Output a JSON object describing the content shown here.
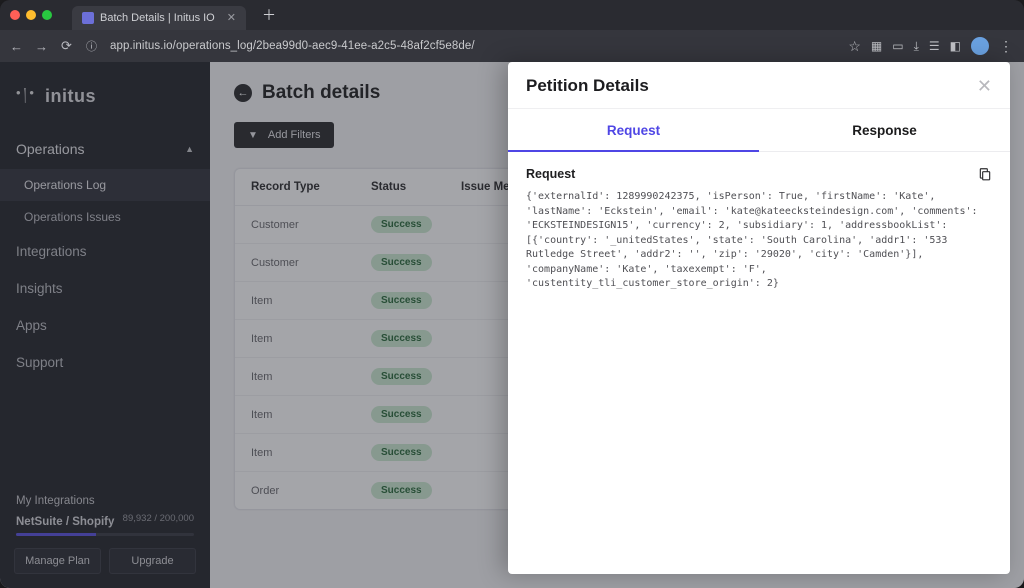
{
  "browser": {
    "tab_title": "Batch Details | Initus IO",
    "url": "app.initus.io/operations_log/2bea99d0-aec9-41ee-a2c5-48af2cf5e8de/"
  },
  "sidebar": {
    "brand": "initus",
    "sections": {
      "operations": {
        "label": "Operations"
      }
    },
    "items": [
      {
        "label": "Operations Log"
      },
      {
        "label": "Operations Issues"
      }
    ],
    "links": {
      "integrations": "Integrations",
      "insights": "Insights",
      "apps": "Apps",
      "support": "Support"
    },
    "my_integrations_label": "My Integrations",
    "integration": {
      "name": "NetSuite / Shopify",
      "count": "89,932 / 200,000"
    },
    "manage_plan": "Manage Plan",
    "upgrade": "Upgrade"
  },
  "main": {
    "title": "Batch details",
    "add_filters": "Add Filters",
    "columns": {
      "record_type": "Record Type",
      "status": "Status",
      "issue_message": "Issue Message"
    },
    "rows": [
      {
        "type": "Customer",
        "status": "Success"
      },
      {
        "type": "Customer",
        "status": "Success"
      },
      {
        "type": "Item",
        "status": "Success"
      },
      {
        "type": "Item",
        "status": "Success"
      },
      {
        "type": "Item",
        "status": "Success"
      },
      {
        "type": "Item",
        "status": "Success"
      },
      {
        "type": "Item",
        "status": "Success"
      },
      {
        "type": "Order",
        "status": "Success"
      }
    ]
  },
  "panel": {
    "title": "Petition Details",
    "tabs": {
      "request": "Request",
      "response": "Response"
    },
    "section_label": "Request",
    "code": "{'externalId': 1289990242375, 'isPerson': True, 'firstName': 'Kate', 'lastName': 'Eckstein', 'email': 'kate@kateecksteindesign.com', 'comments': 'ECKSTEINDESIGN15', 'currency': 2, 'subsidiary': 1, 'addressbookList': [{'country': '_unitedStates', 'state': 'South Carolina', 'addr1': '533 Rutledge Street', 'addr2': '', 'zip': '29020', 'city': 'Camden'}], 'companyName': 'Kate', 'taxexempt': 'F', 'custentity_tli_customer_store_origin': 2}"
  }
}
